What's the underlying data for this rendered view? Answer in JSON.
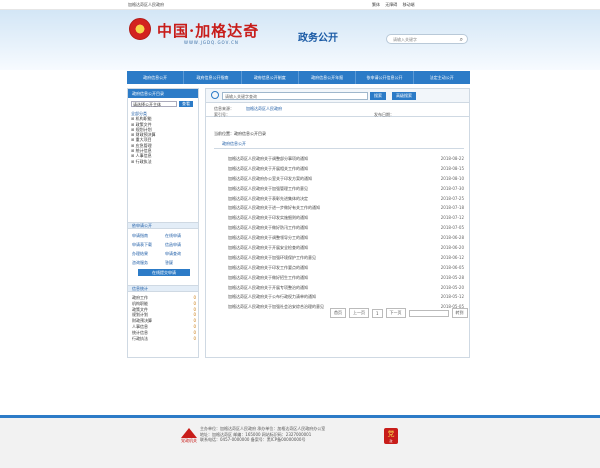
{
  "topbar": {
    "left": "加格达奇区人民政府",
    "right_items": [
      "繁体",
      "无障碍",
      "移动端"
    ]
  },
  "header": {
    "site_title": "中国·加格达奇",
    "site_url": "WWW.JGDQ.GOV.CN",
    "section_title": "政务公开",
    "search_placeholder": "请输入关键字"
  },
  "nav": {
    "items": [
      "政府信息公开",
      "政府信息公开指南",
      "政府信息公开制度",
      "政府信息公开年报",
      "依申请公开信息公开",
      "法定主动公开"
    ]
  },
  "sidebar": {
    "head": "政府信息公开目录",
    "select_value": "请选择公开主体",
    "select_button": "查看",
    "tree": [
      "全部分类",
      "机构职能",
      "政策文件",
      "规划计划",
      "财政预决算",
      "重大项目",
      "应急管理",
      "统计信息",
      "人事信息",
      "行政执法"
    ],
    "links_head": "依申请公开",
    "links": [
      "申请指南",
      "在线申请",
      "申请表下载",
      "信函申请",
      "办理结果",
      "申请查询",
      "咨询服务",
      "答疑"
    ],
    "apply_button": "在线提交申请",
    "stats_head": "信息统计",
    "stats": [
      {
        "name": "政府工作",
        "value": "0"
      },
      {
        "name": "机构职能",
        "value": "0"
      },
      {
        "name": "政策文件",
        "value": "0"
      },
      {
        "name": "规划计划",
        "value": "0"
      },
      {
        "name": "财政预决算",
        "value": "0"
      },
      {
        "name": "人事信息",
        "value": "0"
      },
      {
        "name": "统计信息",
        "value": "0"
      },
      {
        "name": "行政执法",
        "value": "0"
      }
    ]
  },
  "main": {
    "search_value": "请输入关键字查询",
    "search_button": "搜索",
    "advanced_button": "高级搜索",
    "meta_org_label": "信息来源：",
    "meta_org_value": "加格达奇区人民政府",
    "meta_date_label": "发布日期：",
    "meta_index_label": "索引号：",
    "crumb": "当前位置：政府信息公开目录",
    "group_title": "政府信息公开",
    "list": [
      {
        "title": "加格达奇区人民政府关于调整部分事项的通知",
        "date": "2018-08-22"
      },
      {
        "title": "加格达奇区人民政府关于开展相关工作的通知",
        "date": "2018-08-15"
      },
      {
        "title": "加格达奇区人民政府办公室关于印发方案的通知",
        "date": "2018-08-10"
      },
      {
        "title": "加格达奇区人民政府关于加强管理工作的意见",
        "date": "2018-07-30"
      },
      {
        "title": "加格达奇区人民政府关于表彰先进集体的决定",
        "date": "2018-07-25"
      },
      {
        "title": "加格达奇区人民政府关于进一步做好有关工作的通知",
        "date": "2018-07-18"
      },
      {
        "title": "加格达奇区人民政府关于印发实施细则的通知",
        "date": "2018-07-12"
      },
      {
        "title": "加格达奇区人民政府关于做好防汛工作的通知",
        "date": "2018-07-05"
      },
      {
        "title": "加格达奇区人民政府关于调整领导分工的通知",
        "date": "2018-06-28"
      },
      {
        "title": "加格达奇区人民政府关于开展安全检查的通知",
        "date": "2018-06-20"
      },
      {
        "title": "加格达奇区人民政府关于加强环境保护工作的意见",
        "date": "2018-06-12"
      },
      {
        "title": "加格达奇区人民政府关于印发工作要点的通知",
        "date": "2018-06-05"
      },
      {
        "title": "加格达奇区人民政府关于做好招生工作的通知",
        "date": "2018-05-28"
      },
      {
        "title": "加格达奇区人民政府关于开展专项整治的通知",
        "date": "2018-05-20"
      },
      {
        "title": "加格达奇区人民政府关于公布行政权力清单的通知",
        "date": "2018-05-12"
      },
      {
        "title": "加格达奇区人民政府关于加强社会治安综合治理的意见",
        "date": "2018-05-05"
      }
    ],
    "pager": [
      "首页",
      "上一页",
      "1",
      "下一页"
    ],
    "pager_go": "转到"
  },
  "footer": {
    "logo_label": "党政机关",
    "lines": [
      "主办单位：加格达奇区人民政府 承办单位：加格达奇区人民政府办公室",
      "地址：加格达奇区 邮编：165000 网站标识码：2327000001",
      "联系电话：0457-0000000 备案号：黑ICP备00000000号"
    ],
    "badge_text": "党",
    "badge_sub": "政"
  }
}
